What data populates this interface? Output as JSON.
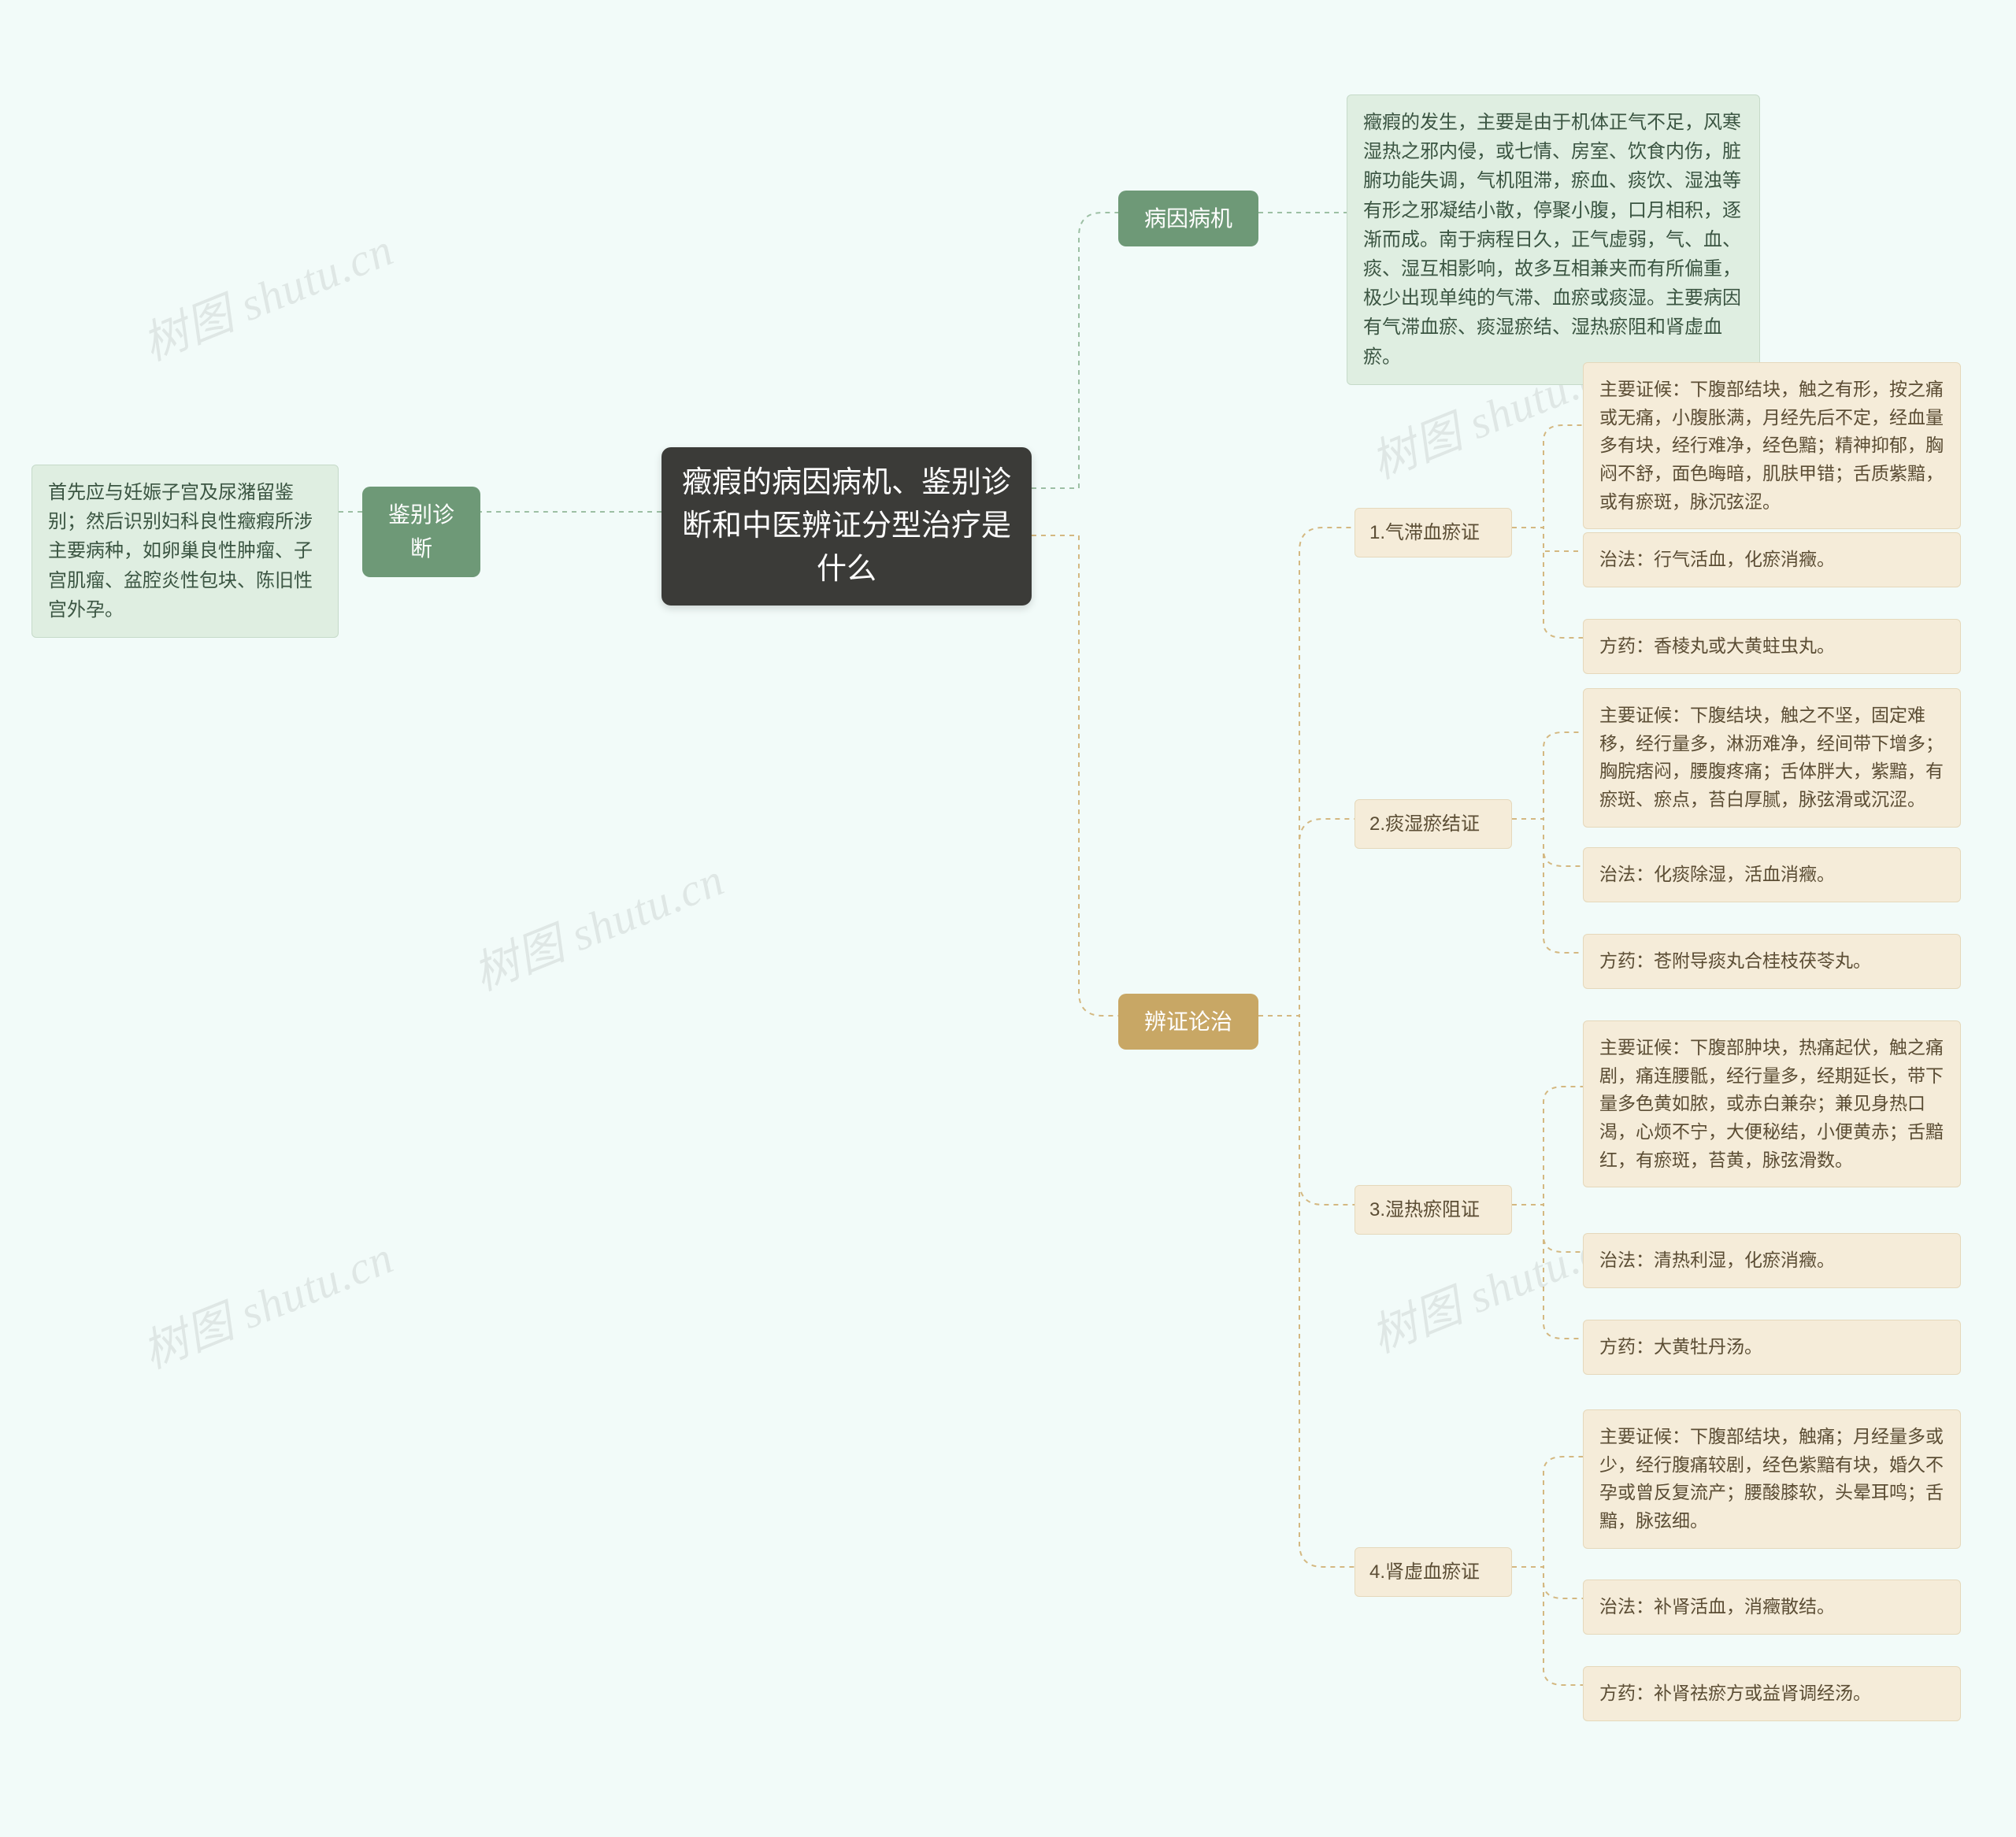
{
  "root": "癥瘕的病因病机、鉴别诊断和中医辨证分型治疗是什么",
  "watermark": "树图 shutu.cn",
  "left": {
    "diag": {
      "label": "鉴别诊断",
      "text": "首先应与妊娠子宫及尿潴留鉴别；然后识别妇科良性癥瘕所涉主要病种，如卵巢良性肿瘤、子宫肌瘤、盆腔炎性包块、陈旧性宫外孕。"
    }
  },
  "right": {
    "etio": {
      "label": "病因病机",
      "text": "癥瘕的发生，主要是由于机体正气不足，风寒湿热之邪内侵，或七情、房室、饮食内伤，脏腑功能失调，气机阻滞，瘀血、痰饮、湿浊等有形之邪凝结小散，停聚小腹，口月相积，逐渐而成。南于病程日久，正气虚弱，气、血、痰、湿互相影响，故多互相兼夹而有所偏重，极少出现单纯的气滞、血瘀或痰湿。主要病因有气滞血瘀、痰湿瘀结、湿热瘀阻和肾虚血瘀。"
    },
    "tx": {
      "label": "辨证论治",
      "patterns": [
        {
          "name": "1.气滞血瘀证",
          "sx": "主要证候：下腹部结块，触之有形，按之痛或无痛，小腹胀满，月经先后不定，经血量多有块，经行难净，经色黯；精神抑郁，胸闷不舒，面色晦暗，肌肤甲错；舌质紫黯，或有瘀斑，脉沉弦涩。",
          "method": "治法：行气活血，化瘀消癥。",
          "rx": "方药：香棱丸或大黄蛀虫丸。"
        },
        {
          "name": "2.痰湿瘀结证",
          "sx": "主要证候：下腹结块，触之不坚，固定难移，经行量多，淋沥难净，经间带下增多；胸脘痞闷，腰腹疼痛；舌体胖大，紫黯，有瘀斑、瘀点，苔白厚腻，脉弦滑或沉涩。",
          "method": "治法：化痰除湿，活血消癥。",
          "rx": "方药：苍附导痰丸合桂枝茯苓丸。"
        },
        {
          "name": "3.湿热瘀阻证",
          "sx": "主要证候：下腹部肿块，热痛起伏，触之痛剧，痛连腰骶，经行量多，经期延长，带下量多色黄如脓，或赤白兼杂；兼见身热口渴，心烦不宁，大便秘结，小便黄赤；舌黯红，有瘀斑，苔黄，脉弦滑数。",
          "method": "治法：清热利湿，化瘀消癥。",
          "rx": "方药：大黄牡丹汤。"
        },
        {
          "name": "4.肾虚血瘀证",
          "sx": "主要证候：下腹部结块，触痛；月经量多或少，经行腹痛较剧，经色紫黯有块，婚久不孕或曾反复流产；腰酸膝软，头晕耳鸣；舌黯，脉弦细。",
          "method": "治法：补肾活血，消癥散结。",
          "rx": "方药：补肾祛瘀方或益肾调经汤。"
        }
      ]
    }
  }
}
